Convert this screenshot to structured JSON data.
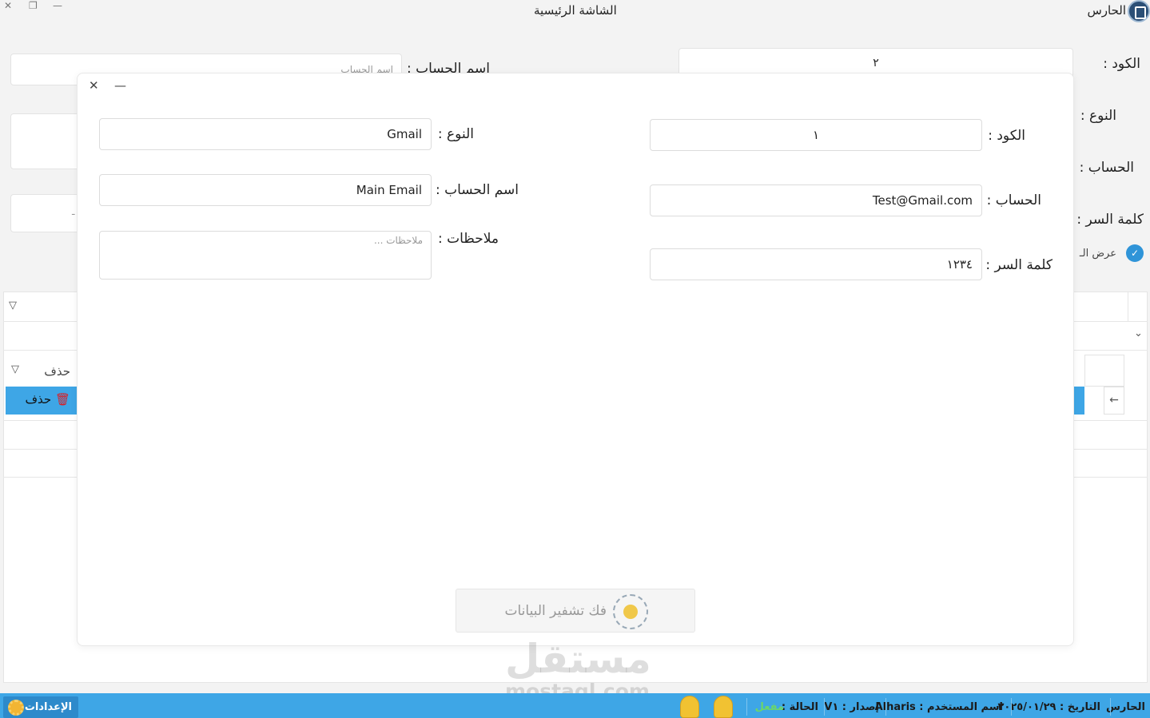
{
  "window": {
    "app_name": "الحارس",
    "title": "الشاشة الرئيسية",
    "close": "✕",
    "restore": "❐",
    "minimize": "—"
  },
  "background_form": {
    "code_label": "الكود :",
    "code_value": "٢",
    "type_label": "النوع :",
    "account_label": "الحساب :",
    "password_label": "كلمة السر :",
    "account_name_label": "اسم الحساب :",
    "account_name_placeholder": "اسم الحساب",
    "show_label": "عرض الـ",
    "partial_char": "ـ"
  },
  "grid": {
    "delete_header": "حذف",
    "delete_button": "حذف",
    "nav_arrow": "←",
    "chevron": "⌄"
  },
  "dialog": {
    "close": "✕",
    "minimize": "—",
    "code_label": "الكود :",
    "code_value": "١",
    "account_label": "الحساب :",
    "account_value": "Test@Gmail.com",
    "password_label": "كلمة السر :",
    "password_value": "١٢٣٤",
    "type_label": "النوع :",
    "type_value": "Gmail",
    "account_name_label": "اسم الحساب :",
    "account_name_value": "Main Email",
    "notes_label": "ملاحظات :",
    "notes_placeholder": "ملاحظات ...",
    "decrypt_button": "فك تشفير البيانات"
  },
  "watermark": {
    "main": "مستقل",
    "sub": "mostaql.com"
  },
  "statusbar": {
    "app_name": "الحارس",
    "date": "التاريخ : ٢٠٢٥/٠١/٢٩",
    "user": "اسم المستخدم : Alharis",
    "version": "إصدار : V١",
    "status_label": "الحالة :",
    "status_value": "مفعل",
    "settings": "الإعدادات"
  },
  "colors": {
    "accent": "#3ea6e6",
    "active_status": "#6bd66b",
    "delete_icon": "#d91f26"
  }
}
